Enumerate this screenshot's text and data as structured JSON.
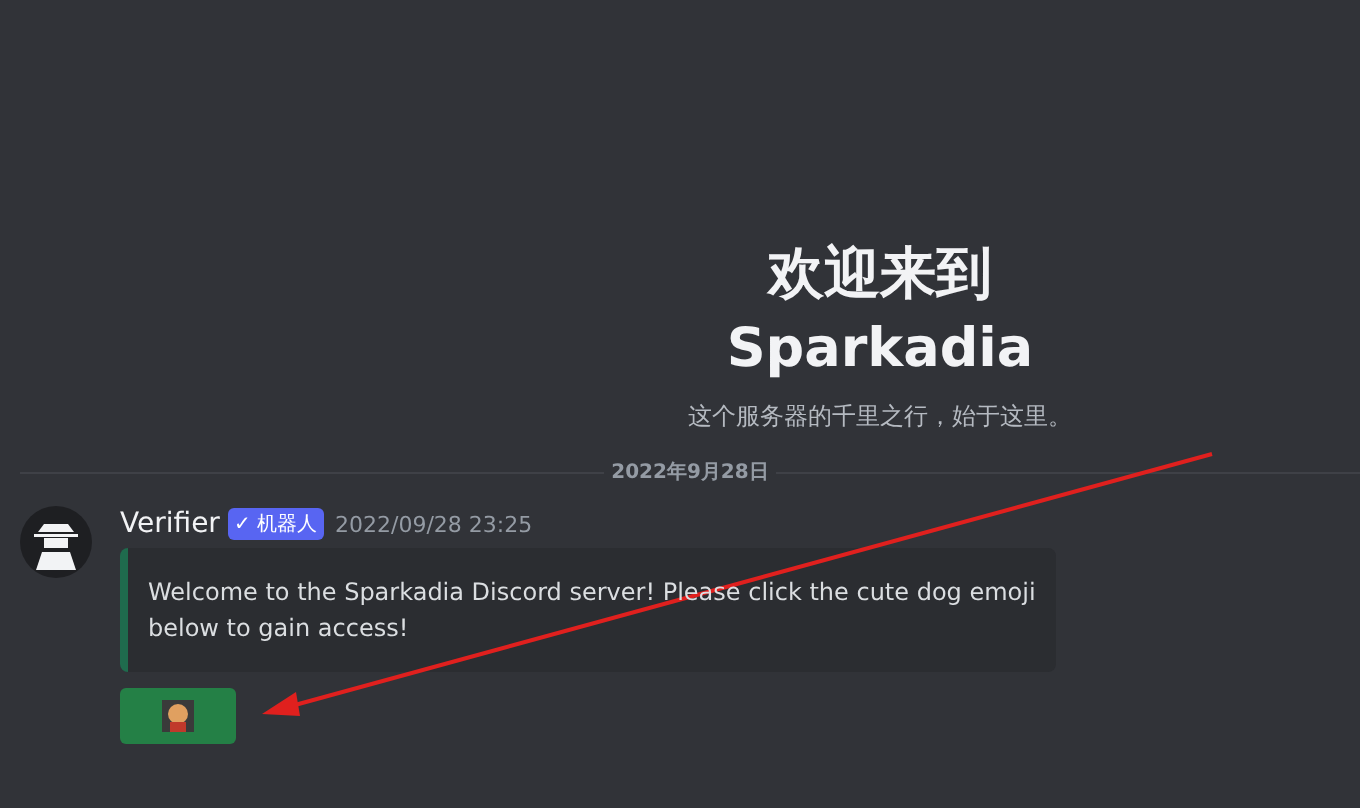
{
  "welcome": {
    "title": "欢迎来到",
    "server_name": "Sparkadia",
    "subtitle": "这个服务器的千里之行，始于这里。"
  },
  "date_divider": "2022年9月28日",
  "message": {
    "author": "Verifier",
    "badge": "✓ 机器人",
    "timestamp": "2022/09/28 23:25",
    "embed_text": "Welcome to the Sparkadia Discord server! Please click the cute dog emoji below to gain access!"
  }
}
